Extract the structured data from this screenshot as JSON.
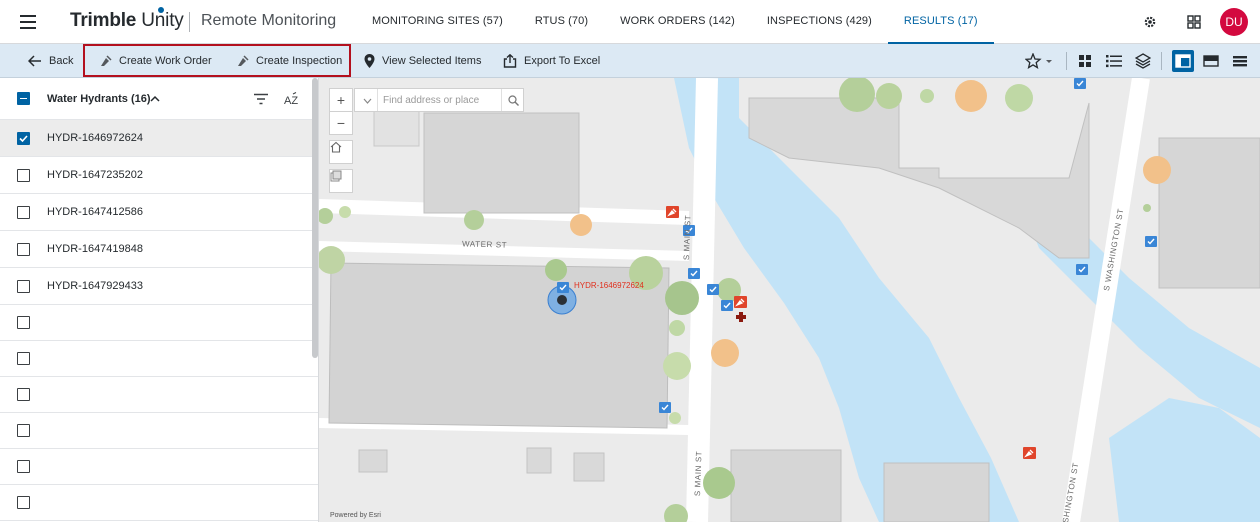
{
  "header": {
    "brand_bold": "Trimble",
    "brand_light": "Unity",
    "product": "Remote Monitoring",
    "tabs": [
      {
        "label": "MONITORING SITES (57)",
        "active": false
      },
      {
        "label": "RTUS (70)",
        "active": false
      },
      {
        "label": "WORK ORDERS (142)",
        "active": false
      },
      {
        "label": "INSPECTIONS (429)",
        "active": false
      },
      {
        "label": "RESULTS (17)",
        "active": true
      }
    ],
    "user_initials": "DU",
    "colors": {
      "accent": "#0063a3",
      "avatar": "#d3093f"
    }
  },
  "toolbar": {
    "back": "Back",
    "create_work_order": "Create Work Order",
    "create_inspection": "Create Inspection",
    "view_selected": "View Selected Items",
    "export_excel": "Export To Excel",
    "highlight_color": "#b3101e"
  },
  "list": {
    "group_label": "Water Hydrants (16)",
    "rows": [
      {
        "label": "HYDR-1646972624",
        "checked": true
      },
      {
        "label": "HYDR-1647235202",
        "checked": false
      },
      {
        "label": "HYDR-1647412586",
        "checked": false
      },
      {
        "label": "HYDR-1647419848",
        "checked": false
      },
      {
        "label": "HYDR-1647929433",
        "checked": false
      },
      {
        "label": "",
        "checked": false
      },
      {
        "label": "",
        "checked": false
      },
      {
        "label": "",
        "checked": false
      },
      {
        "label": "",
        "checked": false
      },
      {
        "label": "",
        "checked": false
      },
      {
        "label": "",
        "checked": false
      }
    ]
  },
  "map": {
    "search_placeholder": "Find address or place",
    "streets": {
      "water_st": "WATER ST",
      "s_main_st": "S MAIN ST",
      "s_main_st_2": "S MAIN ST",
      "s_washington_st": "S WASHINGTON ST",
      "s_washington_st_2": "SHINGTON ST"
    },
    "selected_marker_label": "HYDR-1646972624",
    "attribution": "Powered by Esri"
  }
}
